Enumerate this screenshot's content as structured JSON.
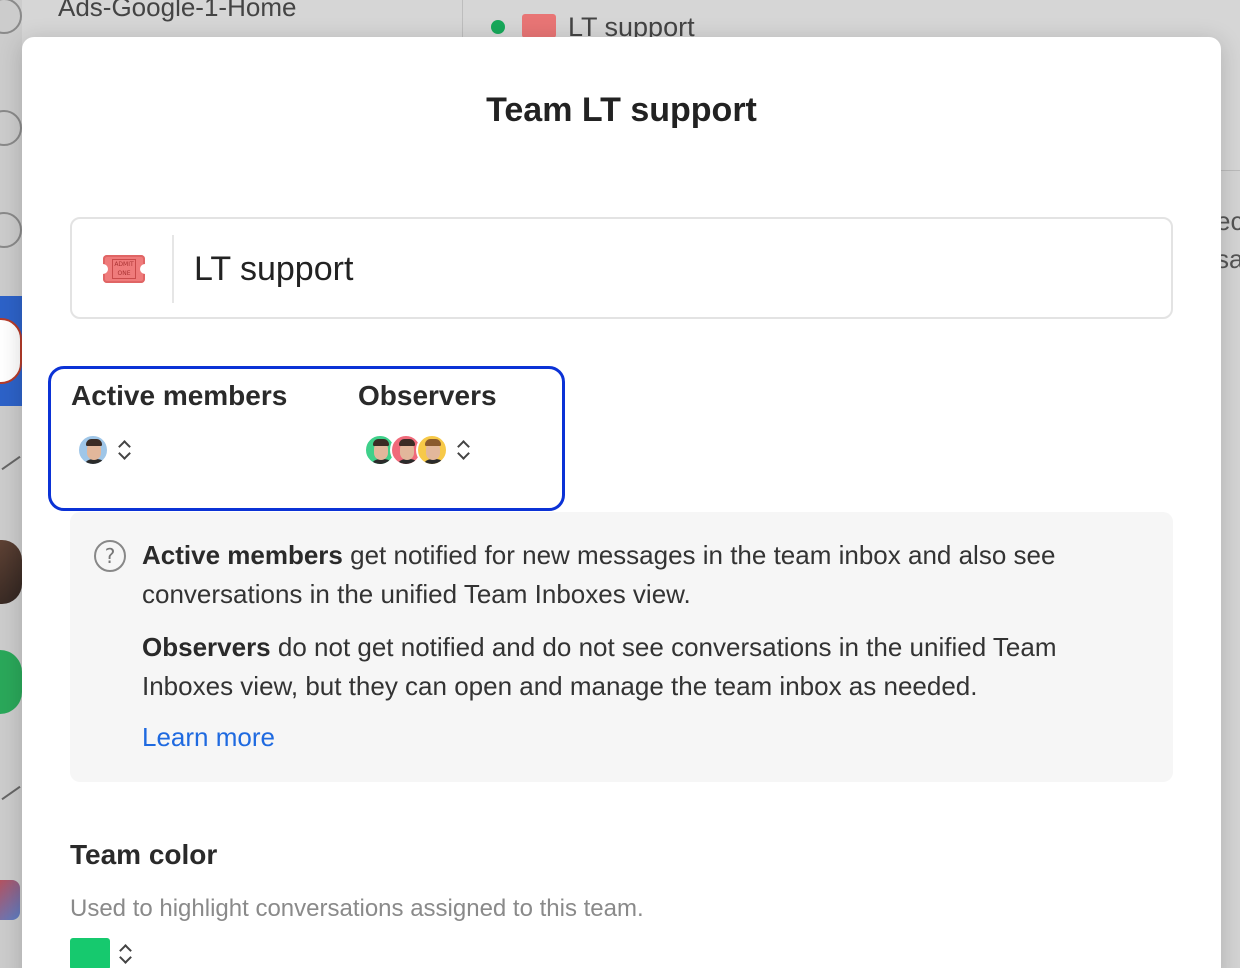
{
  "background": {
    "conversation_title": "Ads-Google-1-Home",
    "team_name": "LT support",
    "right_snippets": [
      "ec",
      "sa"
    ]
  },
  "modal": {
    "title_prefix": "Team",
    "title_name": "LT support",
    "team_icon": "admit-one-ticket-icon",
    "ticket_text": "ADMIT ONE",
    "team_name_value": "LT support",
    "active_members": {
      "label": "Active members",
      "avatar_count": 1
    },
    "observers": {
      "label": "Observers",
      "avatar_count": 3
    },
    "info": {
      "active_bold": "Active members",
      "active_text": " get notified for new messages in the team inbox and also see conversations in the unified Team Inboxes view.",
      "observers_bold": "Observers",
      "observers_text": " do not get notified and do not see conversations in the unified Team Inboxes view, but they can open and manage the team inbox as needed.",
      "learn_more": "Learn more"
    },
    "team_color": {
      "title": "Team color",
      "description": "Used to highlight conversations assigned to this team.",
      "selected_color": "#16c96e"
    }
  },
  "colors": {
    "highlight_border": "#0b32d6",
    "link": "#1f6ae0",
    "status_online": "#17a85a"
  }
}
